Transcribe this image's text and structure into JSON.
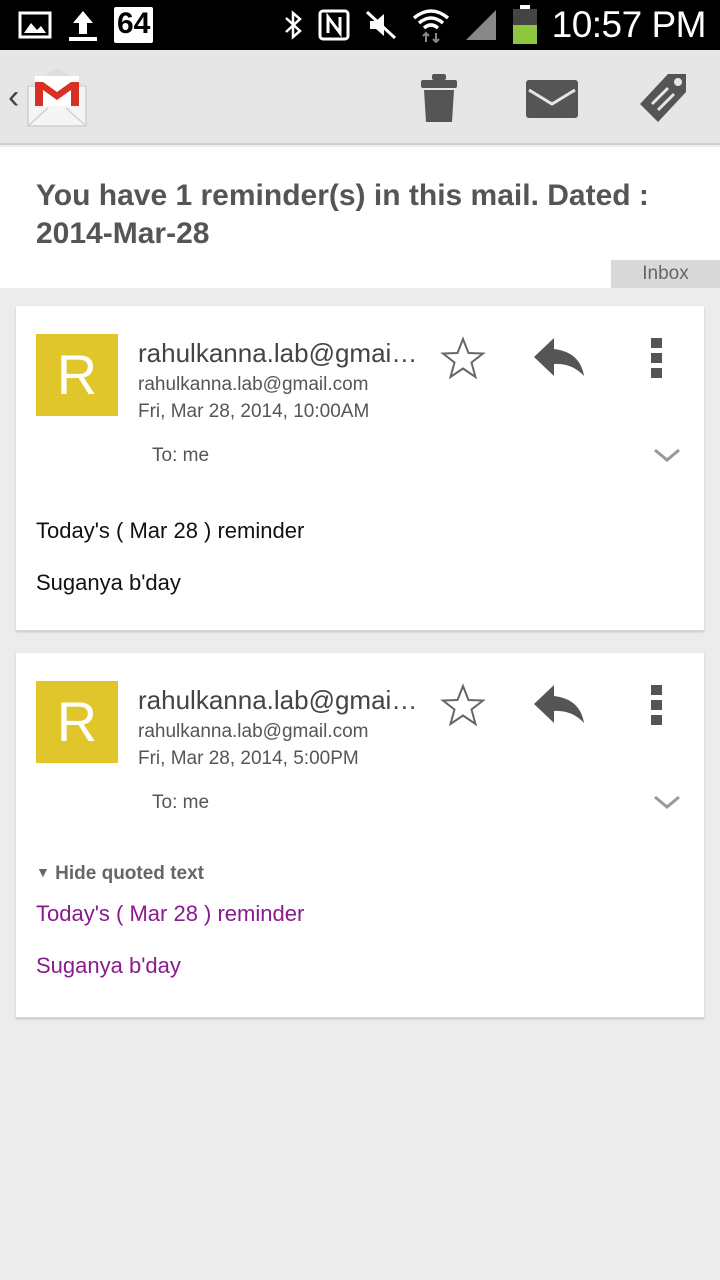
{
  "status_bar": {
    "badge": "64",
    "time": "10:57 PM",
    "icons": [
      "gallery-icon",
      "upload-icon",
      "bluetooth-icon",
      "nfc-icon",
      "mute-icon",
      "wifi-icon",
      "signal-icon",
      "battery-icon"
    ]
  },
  "action_bar": {
    "icons": [
      "back-chevron-icon",
      "gmail-logo",
      "delete-icon",
      "mark-unread-icon",
      "label-icon"
    ]
  },
  "subject": "You have 1  reminder(s) in this mail. Dated : 2014-Mar-28",
  "label": "Inbox",
  "messages": [
    {
      "avatar_letter": "R",
      "sender_name": "rahulkanna.lab@gmail.com",
      "sender_email": "rahulkanna.lab@gmail.com",
      "date": "Fri, Mar 28, 2014, 10:00AM",
      "to": "To: me",
      "body": [
        "Today's ( Mar 28 ) reminder",
        "Suganya b'day"
      ]
    },
    {
      "avatar_letter": "R",
      "sender_name": "rahulkanna.lab@gmail.com",
      "sender_email": "rahulkanna.lab@gmail.com",
      "date": "Fri, Mar 28, 2014, 5:00PM",
      "to": "To: me",
      "hide_quoted": "Hide quoted text",
      "quoted": [
        "Today's ( Mar 28 ) reminder",
        "Suganya b'day"
      ]
    }
  ],
  "colors": {
    "avatar": "#e0c52b",
    "quoted_text": "#8a1a8e",
    "gmail_red": "#d93025"
  }
}
